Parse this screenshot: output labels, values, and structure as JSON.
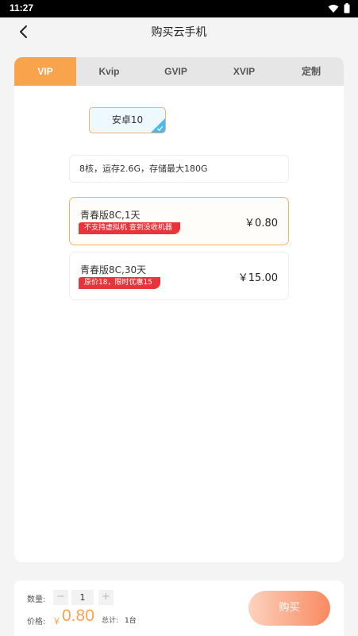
{
  "status": {
    "time": "11:27"
  },
  "header": {
    "title": "购买云手机",
    "back": "back-arrow-icon"
  },
  "tabs": [
    {
      "label": "VIP",
      "active": true
    },
    {
      "label": "Kvip",
      "active": false
    },
    {
      "label": "GVIP",
      "active": false
    },
    {
      "label": "XVIP",
      "active": false
    },
    {
      "label": "定制",
      "active": false
    }
  ],
  "os_option": {
    "label": "安卓10",
    "selected": true
  },
  "spec": "8核，运存2.6G，存储最大180G",
  "plans": [
    {
      "name": "青春版8C,1天",
      "tag": "不支持虚拟机 查到没收机器",
      "price": "￥0.80",
      "selected": true
    },
    {
      "name": "青春版8C,30天",
      "tag": "原价18，限时优惠15",
      "price": "￥15.00",
      "selected": false
    }
  ],
  "footer": {
    "qty_label": "数量:",
    "minus": "−",
    "qty_value": "1",
    "plus": "+",
    "price_label": "价格:",
    "price_symbol": "￥",
    "price_value": "0.80",
    "total_label": "总计:",
    "total_value": "1台",
    "buy_label": "购买"
  },
  "colors": {
    "accent": "#f7a44d",
    "tag_red": "#e8343a",
    "check_blue": "#4bb8f0"
  }
}
